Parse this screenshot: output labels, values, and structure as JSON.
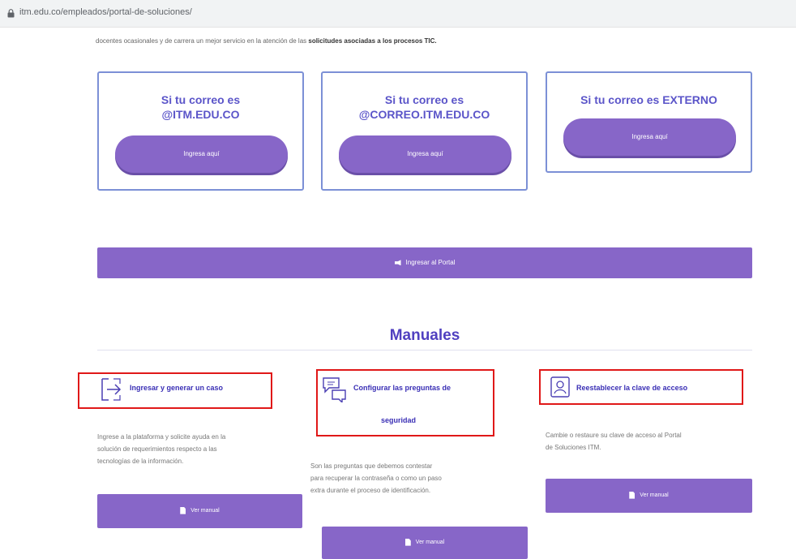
{
  "browser": {
    "url": "itm.edu.co/empleados/portal-de-soluciones/"
  },
  "intro": {
    "text": "docentes ocasionales y de carrera un mejor servicio en la atención de las ",
    "bold": "solicitudes asociadas a los procesos TIC."
  },
  "cards": [
    {
      "title_line1": "Si tu correo es",
      "title_line2": "@ITM.EDU.CO",
      "button": "Ingresa aquí"
    },
    {
      "title_line1": "Si tu correo es",
      "title_line2": "@CORREO.ITM.EDU.CO",
      "button": "Ingresa aquí"
    },
    {
      "title_line1": "Si tu correo es EXTERNO",
      "button": "Ingresa aquí"
    }
  ],
  "portal_button": "Ingresar al Portal",
  "manuales": {
    "heading": "Manuales",
    "items": [
      {
        "title": "Ingresar y generar un caso",
        "icon": "sign-in-icon",
        "desc": [
          "Ingrese a la plataforma y solicite ayuda en la",
          "solución de requerimientos respecto a las",
          "tecnologías de la información."
        ],
        "button": "Ver manual"
      },
      {
        "title_line1": "Configurar las preguntas de",
        "title_line2": "seguridad",
        "icon": "chat-bubbles-icon",
        "desc": [
          "Son las preguntas que debemos contestar",
          "para recuperar la contraseña o como un paso",
          "extra durante el proceso de identificación."
        ],
        "button": "Ver manual"
      },
      {
        "title": "Reestablecer la clave de acceso",
        "icon": "id-card-icon",
        "desc": [
          "Cambie o restaure su clave de acceso al Portal",
          "de Soluciones ITM."
        ],
        "button": "Ver manual"
      }
    ]
  },
  "colors": {
    "accent": "#8766c8",
    "title": "#5b55c9",
    "highlight": "#e01818"
  }
}
